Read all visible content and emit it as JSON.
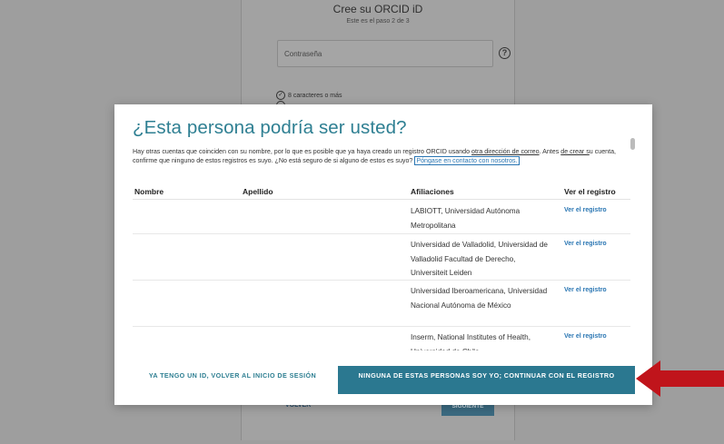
{
  "background_page": {
    "title": "Cree su ORCID iD",
    "step": "Este es el paso 2 de 3",
    "password_placeholder": "Contraseña",
    "requirement_1": "8 caracteres o más",
    "back_label": "VOLVER",
    "next_label": "SIGUIENTE"
  },
  "modal": {
    "title": "¿Esta persona podría ser usted?",
    "intro_1": "Hay otras cuentas que coinciden con su nombre, por lo que es posible que ya haya creado un registro ORCID usando ",
    "intro_link_1": "otra dirección de correo",
    "intro_2": ". Antes ",
    "intro_link_2": "de crear s",
    "intro_3": "u cuenta, confirme que ninguno de estos registros es suyo. ¿No está seguro de si alguno de estos es suyo? ",
    "contact_link": "Póngase en contacto con nosotros.",
    "columns": {
      "first_name": "Nombre",
      "last_name": "Apellido",
      "affiliations": "Afiliaciones",
      "view_record": "Ver el registro"
    },
    "rows": [
      {
        "affiliations": "LABIOTT, Universidad Autónoma Metropolitana",
        "view": "Ver el registro"
      },
      {
        "affiliations": "Universidad de Valladolid, Universidad de Valladolid Facultad de Derecho, Universiteit Leiden",
        "view": "Ver el registro"
      },
      {
        "affiliations": "Universidad Iberoamericana, Universidad Nacional Autónoma de México",
        "view": "Ver el registro"
      },
      {
        "affiliations": "Inserm, National Institutes of Health, Universidad de Chile,",
        "view": "Ver el registro"
      }
    ],
    "back_button": "YA TENGO UN ID, VOLVER AL INICIO DE SESIÓN",
    "continue_button": "NINGUNA DE ESTAS PERSONAS SOY YO; CONTINUAR CON EL REGISTRO"
  },
  "colors": {
    "accent": "#2e7f92",
    "button": "#2b7890",
    "link": "#2a76b3",
    "annotation_arrow": "#c0141b"
  },
  "icons": {
    "help": "question-circle-icon",
    "check": "check-circle-icon",
    "arrow": "red-arrow-annotation-icon"
  }
}
